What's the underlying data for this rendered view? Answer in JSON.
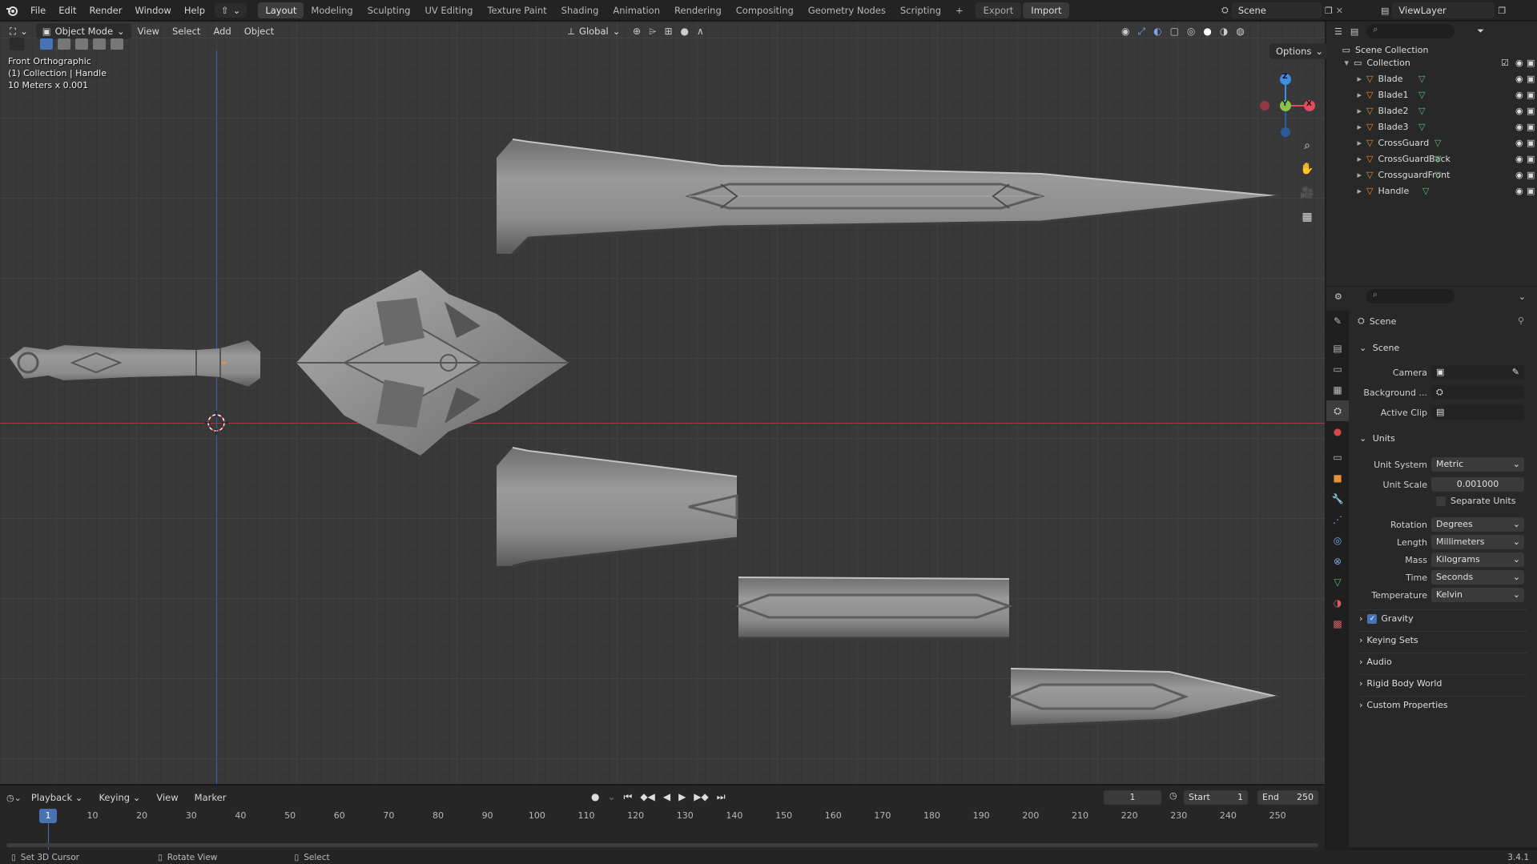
{
  "topbar": {
    "menus": [
      "File",
      "Edit",
      "Render",
      "Window",
      "Help"
    ],
    "workspaces": [
      "Layout",
      "Modeling",
      "Sculpting",
      "UV Editing",
      "Texture Paint",
      "Shading",
      "Animation",
      "Rendering",
      "Compositing",
      "Geometry Nodes",
      "Scripting"
    ],
    "active_workspace": "Layout",
    "export_label": "Export",
    "import_label": "Import",
    "scene_name": "Scene",
    "view_layer": "ViewLayer"
  },
  "viewport": {
    "mode": "Object Mode",
    "menus": [
      "View",
      "Select",
      "Add",
      "Object"
    ],
    "transform_orientation": "Global",
    "options_label": "Options",
    "info": {
      "view_name": "Front Orthographic",
      "collection_line": "(1) Collection | Handle",
      "scale_line": "10 Meters x 0.001"
    },
    "gizmo_axes": [
      "Z",
      "Y",
      "X"
    ]
  },
  "outliner": {
    "root": "Scene Collection",
    "collection": "Collection",
    "objects": [
      "Blade",
      "Blade1",
      "Blade2",
      "Blade3",
      "CrossGuard",
      "CrossGuardBack",
      "CrossguardFront",
      "Handle"
    ]
  },
  "properties": {
    "context_title": "Scene",
    "scene_section": "Scene",
    "camera_label": "Camera",
    "background_label": "Background ...",
    "active_clip_label": "Active Clip",
    "units_section": "Units",
    "unit_rows": [
      {
        "label": "Unit System",
        "value": "Metric"
      },
      {
        "label": "Unit Scale",
        "value": "0.001000"
      },
      {
        "label": "Rotation",
        "value": "Degrees"
      },
      {
        "label": "Length",
        "value": "Millimeters"
      },
      {
        "label": "Mass",
        "value": "Kilograms"
      },
      {
        "label": "Time",
        "value": "Seconds"
      },
      {
        "label": "Temperature",
        "value": "Kelvin"
      }
    ],
    "separate_units": "Separate Units",
    "collapsed_sections": [
      "Gravity",
      "Keying Sets",
      "Audio",
      "Rigid Body World",
      "Custom Properties"
    ]
  },
  "timeline": {
    "menus": [
      "Playback",
      "Keying",
      "View",
      "Marker"
    ],
    "current_frame": "1",
    "start_label": "Start",
    "start_value": "1",
    "end_label": "End",
    "end_value": "250",
    "ticks": [
      "1",
      "10",
      "20",
      "30",
      "40",
      "50",
      "60",
      "70",
      "80",
      "90",
      "100",
      "110",
      "120",
      "130",
      "140",
      "150",
      "160",
      "170",
      "180",
      "190",
      "200",
      "210",
      "220",
      "230",
      "240",
      "250"
    ]
  },
  "statusbar": {
    "hint1": "Set 3D Cursor",
    "hint2": "Rotate View",
    "hint3": "Select",
    "version": "3.4.1"
  },
  "colors": {
    "accent_blue": "#4772b3",
    "axis_x": "#e34a5e",
    "axis_y": "#8bc34a",
    "axis_z": "#3d8fe0",
    "object_orange": "#e8913a",
    "mesh_green": "#5fbf7a"
  }
}
